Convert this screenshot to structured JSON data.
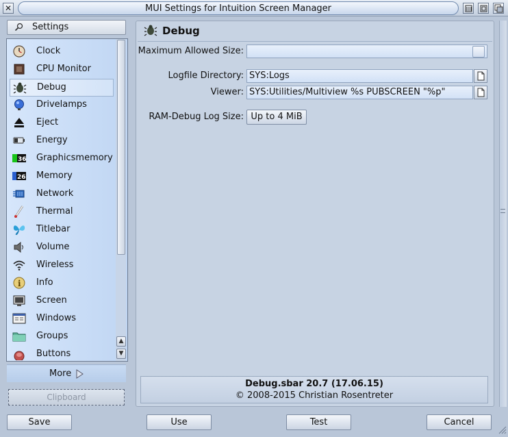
{
  "window": {
    "title": "MUI Settings for Intuition Screen Manager"
  },
  "sidebar": {
    "header_label": "Settings",
    "items": [
      {
        "label": "Clock",
        "icon": "clock-icon"
      },
      {
        "label": "CPU Monitor",
        "icon": "cpu-monitor-icon"
      },
      {
        "label": "Debug",
        "icon": "bug-icon",
        "selected": true
      },
      {
        "label": "Drivelamps",
        "icon": "drivelamp-icon"
      },
      {
        "label": "Eject",
        "icon": "eject-icon"
      },
      {
        "label": "Energy",
        "icon": "battery-icon"
      },
      {
        "label": "Graphicsmemory",
        "icon": "graphics-memory-icon",
        "badge": "36"
      },
      {
        "label": "Memory",
        "icon": "memory-icon",
        "badge": "26"
      },
      {
        "label": "Network",
        "icon": "network-icon"
      },
      {
        "label": "Thermal",
        "icon": "thermometer-icon"
      },
      {
        "label": "Titlebar",
        "icon": "butterfly-icon"
      },
      {
        "label": "Volume",
        "icon": "speaker-icon"
      },
      {
        "label": "Wireless",
        "icon": "wifi-icon"
      },
      {
        "label": "Info",
        "icon": "info-icon"
      },
      {
        "label": "Screen",
        "icon": "screen-icon"
      },
      {
        "label": "Windows",
        "icon": "windows-icon"
      },
      {
        "label": "Groups",
        "icon": "folder-icon"
      },
      {
        "label": "Buttons",
        "icon": "buttons-icon"
      }
    ],
    "more_label": "More",
    "clipboard_label": "Clipboard"
  },
  "panel": {
    "title": "Debug",
    "max_size_label": "Maximum Allowed Size:",
    "max_size_value": "",
    "logfile_dir_label": "Logfile Directory:",
    "logfile_dir_value": "SYS:Logs",
    "viewer_label": "Viewer:",
    "viewer_value": "SYS:Utilities/Multiview %s PUBSCREEN \"%p\"",
    "ram_debug_label": "RAM-Debug Log Size:",
    "ram_debug_value": "Up to 4 MiB",
    "info_name": "Debug.sbar 20.7 (17.06.15)",
    "info_copyright": "© 2008-2015 Christian Rosentreter"
  },
  "buttons": {
    "save": "Save",
    "use": "Use",
    "test": "Test",
    "cancel": "Cancel"
  }
}
